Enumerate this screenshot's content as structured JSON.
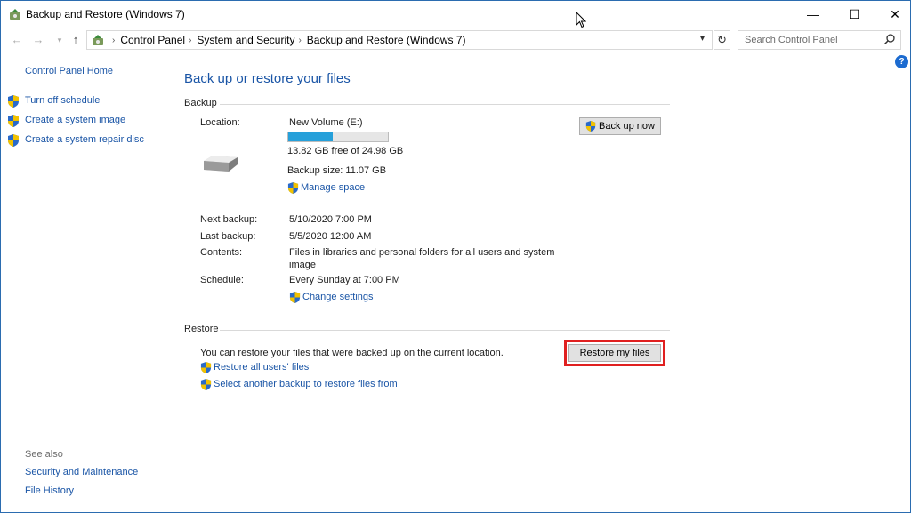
{
  "window": {
    "title": "Backup and Restore (Windows 7)",
    "minimize": "—",
    "maximize": "☐",
    "close": "✕"
  },
  "address_bar": {
    "crumbs": [
      "Control Panel",
      "System and Security",
      "Backup and Restore (Windows 7)"
    ],
    "search_placeholder": "Search Control Panel"
  },
  "left_pane": {
    "home": "Control Panel Home",
    "tasks": [
      "Turn off schedule",
      "Create a system image",
      "Create a system repair disc"
    ],
    "see_also_title": "See also",
    "see_also": [
      "Security and Maintenance",
      "File History"
    ]
  },
  "main": {
    "title": "Back up or restore your files",
    "backup": {
      "heading": "Backup",
      "location_label": "Location:",
      "location_value": "New Volume (E:)",
      "used_fraction": 0.45,
      "free_text": "13.82 GB free of 24.98 GB",
      "backup_size": "Backup size: 11.07 GB",
      "manage_space": "Manage space",
      "back_up_now": "Back up now",
      "next_backup_label": "Next backup:",
      "next_backup_value": "5/10/2020 7:00 PM",
      "last_backup_label": "Last backup:",
      "last_backup_value": "5/5/2020 12:00 AM",
      "contents_label": "Contents:",
      "contents_value_line1": "Files in libraries and personal folders for all users and system",
      "contents_value_line2": "image",
      "schedule_label": "Schedule:",
      "schedule_value": "Every Sunday at 7:00 PM",
      "change_settings": "Change settings"
    },
    "restore": {
      "heading": "Restore",
      "description": "You can restore your files that were backed up on the current location.",
      "restore_my_files": "Restore my files",
      "restore_all_users": "Restore all users' files",
      "select_another": "Select another backup to restore files from"
    }
  },
  "colors": {
    "link": "#1a55a6",
    "progress": "#26a0da",
    "highlight": "#e02020"
  }
}
